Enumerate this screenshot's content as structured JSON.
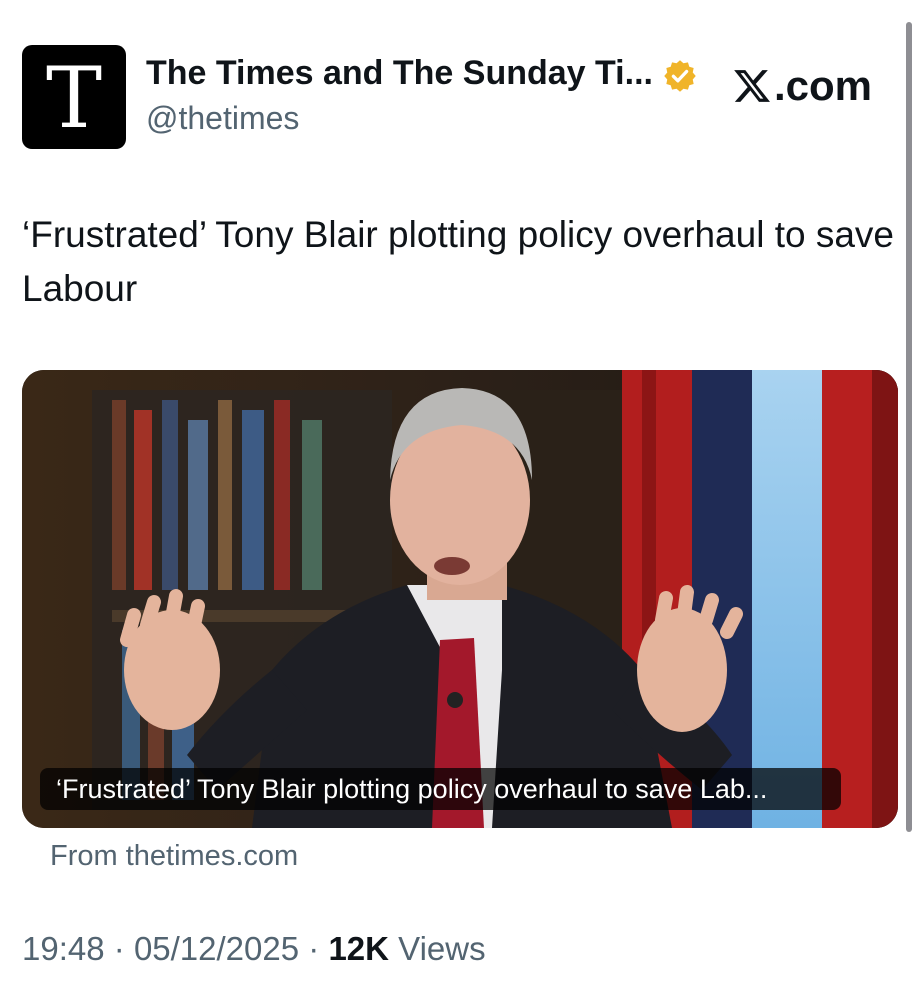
{
  "account": {
    "initial": "T",
    "name": "The Times and The Sunday Ti...",
    "handle": "@thetimes",
    "verified_badge_color": "#f0b429"
  },
  "watermark": {
    "icon": "x-logo-icon",
    "domain": ".com"
  },
  "tweet": {
    "text": "‘Frustrated’ Tony Blair plotting policy overhaul to save Labour"
  },
  "card": {
    "caption": "‘Frustrated’ Tony Blair plotting policy overhaul to save Lab...",
    "source": "From thetimes.com"
  },
  "meta": {
    "time": "19:48",
    "sep1": "·",
    "date": "05/12/2025",
    "sep2": "·",
    "views_count": "12K",
    "views_label": "Views"
  },
  "colors": {
    "text": "#0f1419",
    "secondary": "#536471"
  }
}
